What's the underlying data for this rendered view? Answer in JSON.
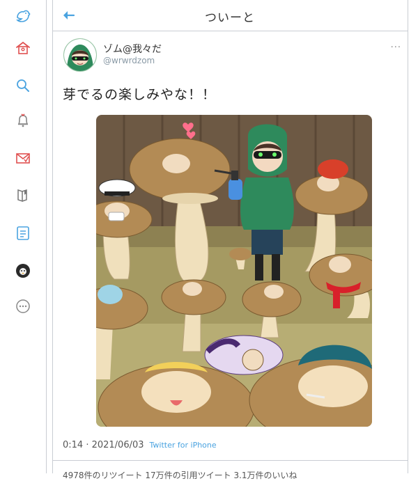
{
  "header": {
    "title": "ついーと",
    "back_icon": "arrow-left-icon"
  },
  "sidebar": {
    "items": [
      {
        "name": "bird-logo-icon",
        "color": "#4aa3e0"
      },
      {
        "name": "home-icon",
        "color": "#e05050"
      },
      {
        "name": "search-icon",
        "color": "#4aa3e0"
      },
      {
        "name": "bell-icon",
        "color": "#e05050"
      },
      {
        "name": "mail-icon",
        "color": "#e05050"
      },
      {
        "name": "bookmark-icon",
        "color": "#777777"
      },
      {
        "name": "list-icon",
        "color": "#4aa3e0"
      },
      {
        "name": "profile-avatar-icon",
        "color": "#333333"
      },
      {
        "name": "more-icon",
        "color": "#888888"
      }
    ]
  },
  "tweet": {
    "author_name": "ゾム@我々だ",
    "author_handle": "@wrwrdzom",
    "more_label": "···",
    "text": "芽でるの楽しみやな！！",
    "timestamp": "0:14 · 2021/06/03",
    "via": "Twitter for iPhone",
    "stats": "4978件のリツイート  17万件の引用ツイート  3.1万件のいいね"
  },
  "colors": {
    "accent": "#4aa3e0",
    "rule": "#c9cdd3",
    "mushroom_cap": "#b38b55",
    "hoodie": "#2e8a5c"
  }
}
